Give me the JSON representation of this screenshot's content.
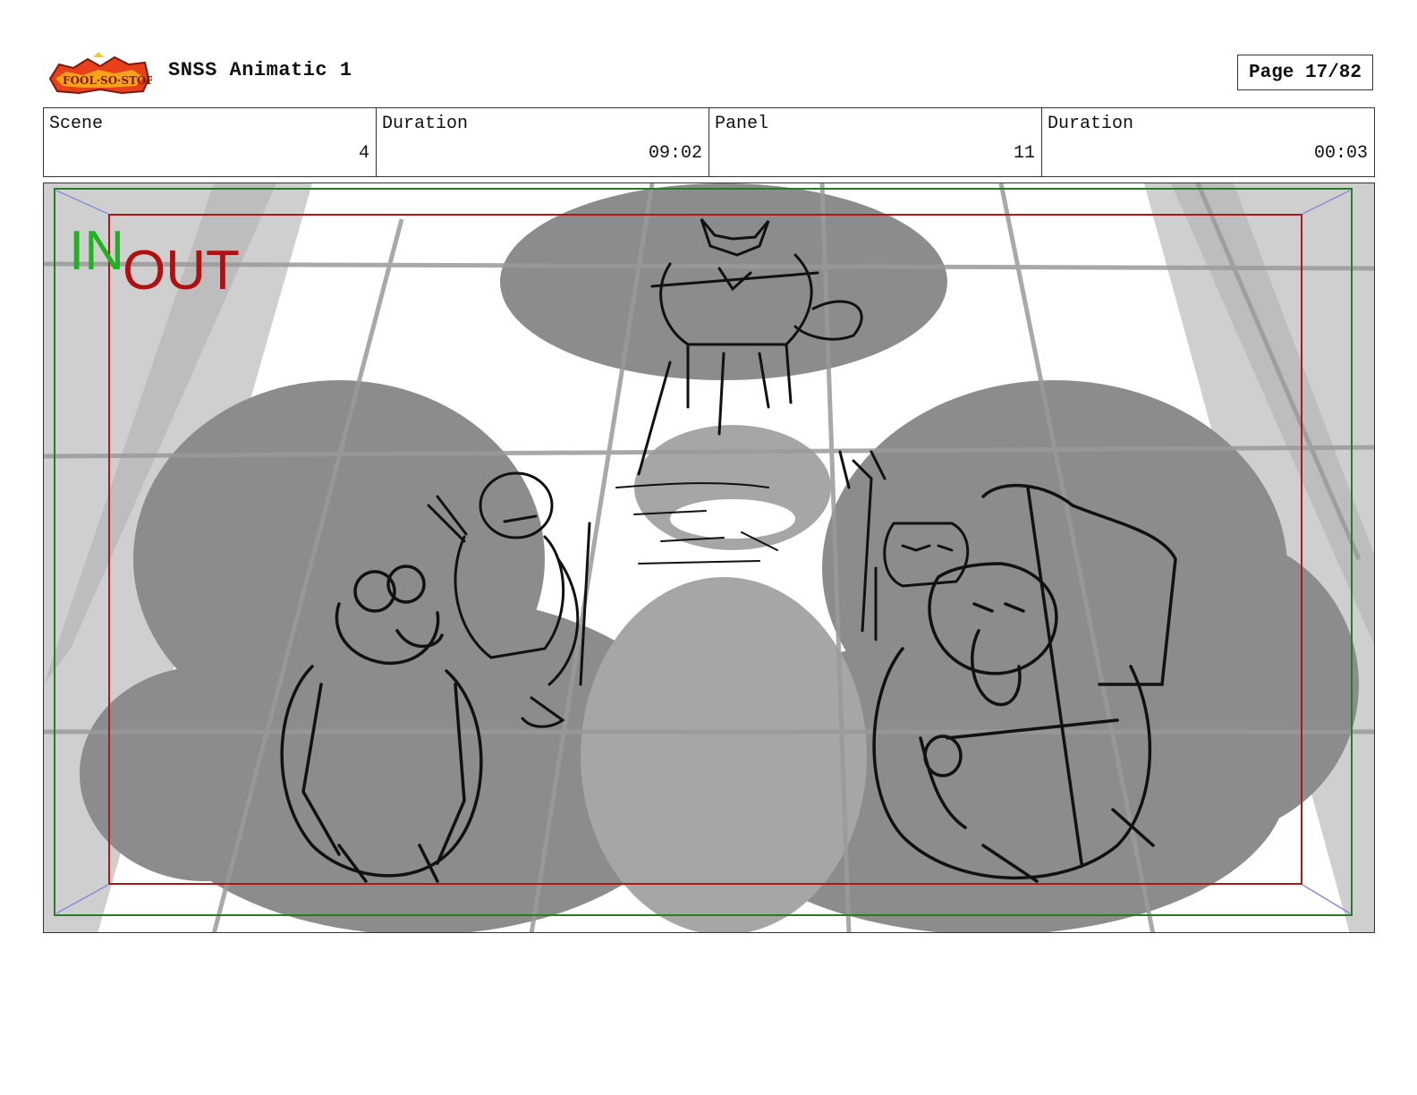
{
  "header": {
    "logo_text": "Sir Fool-So-Stop",
    "title": "SNSS Animatic 1",
    "page": "Page 17/82"
  },
  "info": {
    "scene_label": "Scene",
    "scene_value": "4",
    "scene_duration_label": "Duration",
    "scene_duration_value": "09:02",
    "panel_label": "Panel",
    "panel_value": "11",
    "panel_duration_label": "Duration",
    "panel_duration_value": "00:03"
  },
  "panel": {
    "in_label": "IN",
    "out_label": "OUT",
    "colors": {
      "in": "#1fb31f",
      "out": "#b01010",
      "safe_frame_green": "#2a7a2a",
      "safe_frame_red": "#b01818",
      "corner_arrows": "#8a8ad8"
    },
    "subjects": [
      "wolf-character-sketch",
      "hawk-archer-sketch",
      "goggled-bear-sketch",
      "owl-staff-sketch",
      "bearded-eagle-shield-sketch"
    ]
  }
}
